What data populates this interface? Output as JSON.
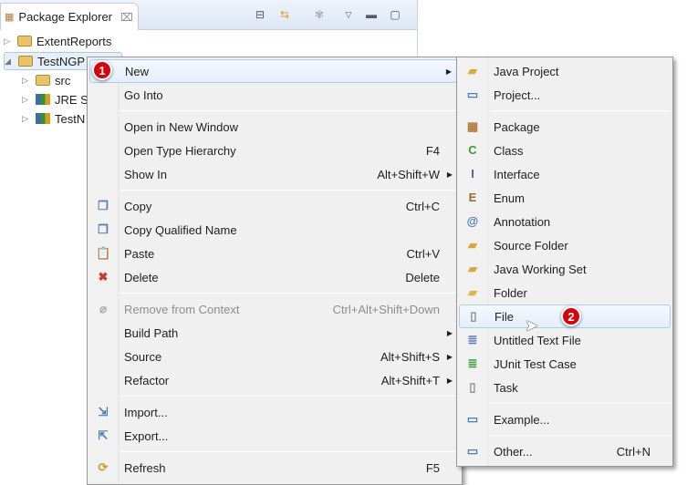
{
  "explorer": {
    "title": "Package Explorer",
    "close": "⌧",
    "tree": [
      {
        "label": "ExtentReports",
        "icon": "project-folder-icon",
        "expanded": false
      },
      {
        "label": "TestNGP",
        "icon": "project-folder-icon",
        "expanded": true,
        "selected": true
      },
      {
        "label": "src",
        "icon": "source-folder-icon",
        "expanded": false
      },
      {
        "label": "JRE S",
        "icon": "library-icon",
        "expanded": false
      },
      {
        "label": "TestN",
        "icon": "library-icon",
        "expanded": false
      }
    ]
  },
  "context_menu": {
    "items": [
      {
        "label": "New",
        "submenu": true,
        "highlighted": true
      },
      {
        "label": "Go Into"
      },
      {
        "sep": true
      },
      {
        "label": "Open in New Window"
      },
      {
        "label": "Open Type Hierarchy",
        "shortcut": "F4"
      },
      {
        "label": "Show In",
        "shortcut": "Alt+Shift+W",
        "submenu": true
      },
      {
        "sep": true
      },
      {
        "label": "Copy",
        "shortcut": "Ctrl+C",
        "icon": "copy-icon",
        "glyph": "❐",
        "color": "#5a7ab0"
      },
      {
        "label": "Copy Qualified Name",
        "icon": "copy-qualified-icon",
        "glyph": "❐",
        "color": "#5a7ab0"
      },
      {
        "label": "Paste",
        "shortcut": "Ctrl+V",
        "icon": "paste-icon",
        "glyph": "📋",
        "color": "#8a6d3b"
      },
      {
        "label": "Delete",
        "shortcut": "Delete",
        "icon": "delete-icon",
        "glyph": "✖",
        "color": "#d0362b"
      },
      {
        "sep": true
      },
      {
        "label": "Remove from Context",
        "shortcut": "Ctrl+Alt+Shift+Down",
        "disabled": true,
        "icon": "remove-context-icon",
        "glyph": "⌀",
        "color": "#aaa"
      },
      {
        "label": "Build Path",
        "submenu": true
      },
      {
        "label": "Source",
        "shortcut": "Alt+Shift+S",
        "submenu": true
      },
      {
        "label": "Refactor",
        "shortcut": "Alt+Shift+T",
        "submenu": true
      },
      {
        "sep": true
      },
      {
        "label": "Import...",
        "icon": "import-icon",
        "glyph": "⇲",
        "color": "#4a7bb5"
      },
      {
        "label": "Export...",
        "icon": "export-icon",
        "glyph": "⇱",
        "color": "#4a7bb5"
      },
      {
        "sep": true
      },
      {
        "label": "Refresh",
        "shortcut": "F5",
        "icon": "refresh-icon",
        "glyph": "⟳",
        "color": "#c9a227"
      }
    ]
  },
  "new_submenu": {
    "items": [
      {
        "label": "Java Project",
        "icon": "java-project-icon",
        "glyph": "▰",
        "color": "#d9a93b"
      },
      {
        "label": "Project...",
        "icon": "project-icon",
        "glyph": "▭",
        "color": "#4a7bb5"
      },
      {
        "sep": true
      },
      {
        "label": "Package",
        "icon": "package-icon",
        "glyph": "▦",
        "color": "#b5793b"
      },
      {
        "label": "Class",
        "icon": "class-icon",
        "glyph": "C",
        "color": "#3c9a3c"
      },
      {
        "label": "Interface",
        "icon": "interface-icon",
        "glyph": "I",
        "color": "#6a4ea0"
      },
      {
        "label": "Enum",
        "icon": "enum-icon",
        "glyph": "E",
        "color": "#9a6a2e"
      },
      {
        "label": "Annotation",
        "icon": "annotation-icon",
        "glyph": "@",
        "color": "#4a7bb5"
      },
      {
        "label": "Source Folder",
        "icon": "source-folder-icon",
        "glyph": "▰",
        "color": "#d9a93b"
      },
      {
        "label": "Java Working Set",
        "icon": "working-set-icon",
        "glyph": "▰",
        "color": "#d9a93b"
      },
      {
        "label": "Folder",
        "icon": "folder-icon",
        "glyph": "▰",
        "color": "#e0b64a"
      },
      {
        "label": "File",
        "icon": "file-icon",
        "glyph": "▯",
        "color": "#888",
        "highlighted": true
      },
      {
        "label": "Untitled Text File",
        "icon": "text-file-icon",
        "glyph": "≣",
        "color": "#5a7ab0"
      },
      {
        "label": "JUnit Test Case",
        "icon": "junit-icon",
        "glyph": "≣",
        "color": "#3c9a3c"
      },
      {
        "label": "Task",
        "icon": "task-icon",
        "glyph": "▯",
        "color": "#888"
      },
      {
        "sep": true
      },
      {
        "label": "Example...",
        "icon": "example-icon",
        "glyph": "▭",
        "color": "#4a7bb5"
      },
      {
        "sep": true
      },
      {
        "label": "Other...",
        "shortcut": "Ctrl+N",
        "icon": "other-wizard-icon",
        "glyph": "▭",
        "color": "#4a7bb5"
      }
    ]
  },
  "badges": [
    "1",
    "2"
  ]
}
